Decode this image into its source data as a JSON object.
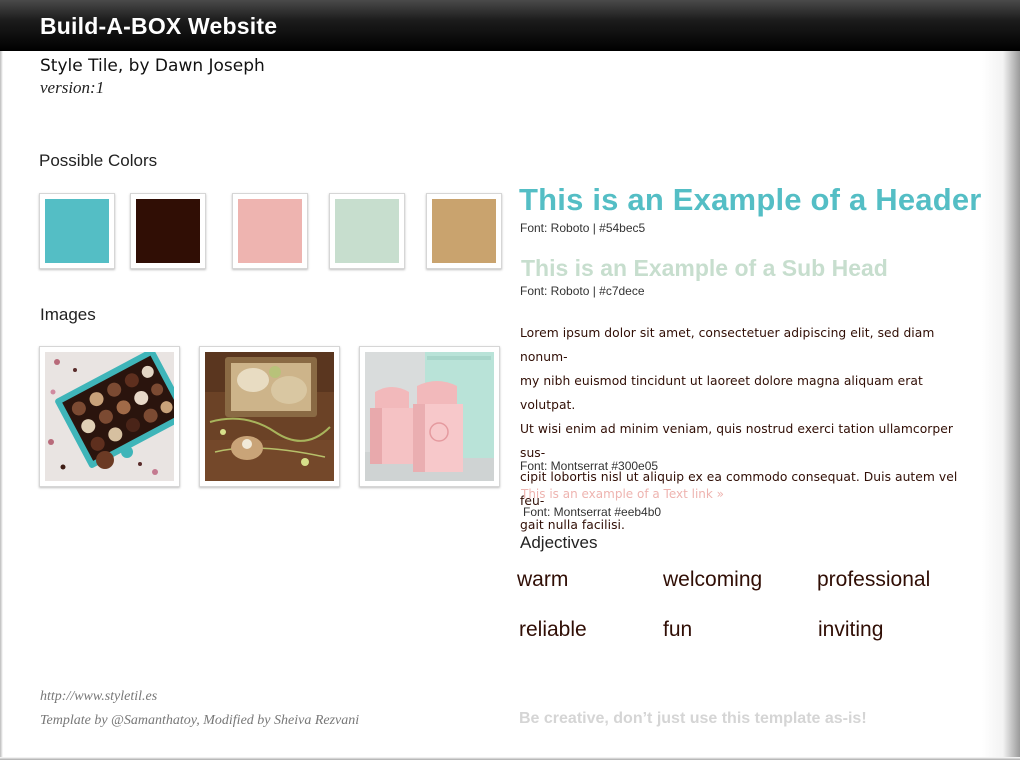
{
  "title_bar": {
    "text": "Build-A-BOX Website"
  },
  "meta": {
    "subtitle": "Style Tile, by Dawn Joseph",
    "version": "version:1"
  },
  "colors": {
    "label": "Possible Colors",
    "swatches": [
      {
        "name": "teal",
        "hex": "#54bec5"
      },
      {
        "name": "dark-brown",
        "hex": "#300e05"
      },
      {
        "name": "pink",
        "hex": "#eeb4b0"
      },
      {
        "name": "mint",
        "hex": "#c7dece"
      },
      {
        "name": "tan",
        "hex": "#c9a36e"
      }
    ]
  },
  "images": {
    "label": "Images",
    "items": [
      {
        "name": "chocolates-box-photo"
      },
      {
        "name": "gift-box-items-photo"
      },
      {
        "name": "pink-mint-boxes-photo"
      }
    ]
  },
  "typography": {
    "header_example": "This is an Example of a Header",
    "header_font": "Font: Roboto  |  #54bec5",
    "subhead_example": "This is an Example of a Sub Head",
    "subhead_font": "Font: Roboto  |  #c7dece",
    "body_lines": [
      "Lorem ipsum dolor sit amet, consectetuer adipiscing elit, sed diam nonum-",
      "my nibh euismod tincidunt ut laoreet dolore magna aliquam erat volutpat.",
      "Ut wisi enim ad minim veniam, quis nostrud exerci tation ullamcorper sus-",
      "cipit lobortis nisl ut aliquip ex ea commodo consequat. Duis autem vel feu-",
      "gait nulla facilisi."
    ],
    "body_font": "Font: Montserrat #300e05",
    "link_text": "This is an example of a Text link »",
    "link_font": "Font: Montserrat  #eeb4b0"
  },
  "adjectives": {
    "label": "Adjectives",
    "words": [
      "warm",
      "welcoming",
      "professional",
      "reliable",
      "fun",
      "inviting"
    ]
  },
  "footer": {
    "url": "http://www.styletil.es",
    "credit": "Template by @Samanthatoy, Modified by Sheiva Rezvani",
    "note": "Be creative, don’t just use this template as-is!"
  }
}
